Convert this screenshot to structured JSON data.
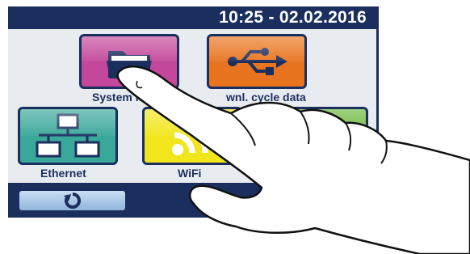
{
  "status_bar": {
    "clock": "10:25 - 02.02.2016"
  },
  "tiles": [
    {
      "label": "System m",
      "icon": "folder-icon",
      "color": "#c3479a"
    },
    {
      "label": "wnl. cycle data",
      "icon": "usb-icon",
      "color": "#e9741f"
    },
    {
      "label": "Ethernet",
      "icon": "network-icon",
      "color": "#39a79a"
    },
    {
      "label": "WiFi",
      "icon": "wifi-icon",
      "color": "#f1e61c"
    },
    {
      "label": "",
      "icon": "",
      "color": "#6ab83a"
    }
  ],
  "bottom_bar": {
    "back_icon": "refresh-icon"
  },
  "colors": {
    "frame": "#1b2f5e",
    "background": "#e8ecf0"
  }
}
